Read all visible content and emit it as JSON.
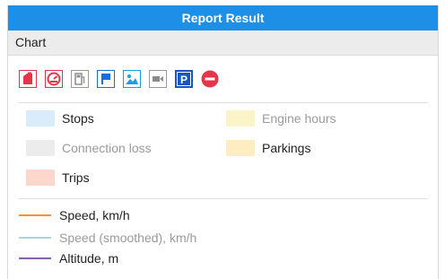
{
  "window": {
    "title": "Report Result"
  },
  "section": {
    "title": "Chart"
  },
  "toolbar": {
    "buttons": [
      {
        "icon": "fuel-can-icon",
        "color": "#e8344a"
      },
      {
        "icon": "speedometer-icon",
        "color": "#e8344a"
      },
      {
        "icon": "fuel-pump-icon",
        "color": "#8c8c8c"
      },
      {
        "icon": "flag-icon",
        "color": "#1a6fd6"
      },
      {
        "icon": "image-icon",
        "color": "#1a9ee6"
      },
      {
        "icon": "video-camera-icon",
        "color": "#8c8c8c"
      },
      {
        "icon": "parking-icon",
        "color": "#1a55c0"
      },
      {
        "icon": "no-entry-icon",
        "color": "#e8344a"
      }
    ]
  },
  "interval_legend": [
    {
      "label": "Stops",
      "color": "#d9ecfb",
      "enabled": true
    },
    {
      "label": "Engine hours",
      "color": "#fbf4c8",
      "enabled": false
    },
    {
      "label": "Connection loss",
      "color": "#ececec",
      "enabled": false
    },
    {
      "label": "Parkings",
      "color": "#fdedc0",
      "enabled": true
    },
    {
      "label": "Trips",
      "color": "#fdd6cc",
      "enabled": true
    }
  ],
  "line_legend": [
    {
      "label": "Speed, km/h",
      "color": "#f0923a",
      "enabled": true
    },
    {
      "label": "Speed (smoothed), km/h",
      "color": "#a8d5e2",
      "enabled": false
    },
    {
      "label": "Altitude, m",
      "color": "#8e5cb0",
      "enabled": true
    }
  ]
}
